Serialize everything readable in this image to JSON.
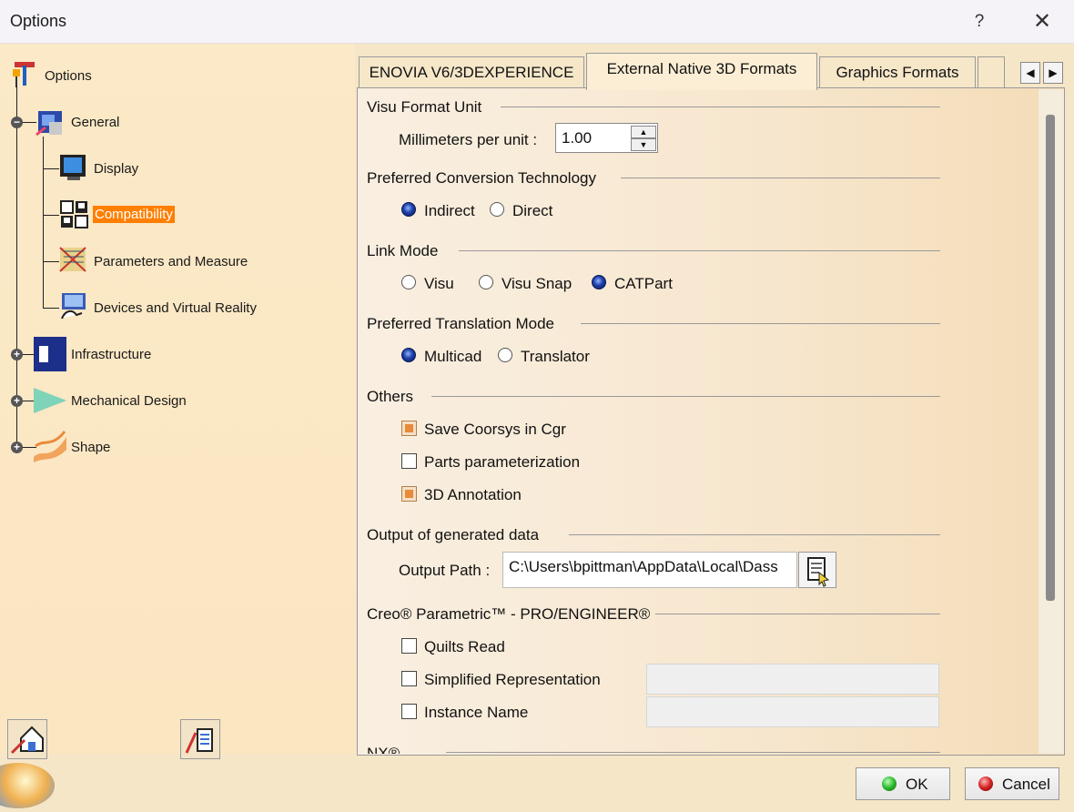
{
  "window": {
    "title": "Options",
    "help_label": "?",
    "close_label": "✕"
  },
  "tree": {
    "root": "Options",
    "items": [
      {
        "label": "General",
        "expander": "−"
      },
      {
        "label": "Display"
      },
      {
        "label": "Compatibility",
        "selected": true
      },
      {
        "label": "Parameters and Measure"
      },
      {
        "label": "Devices and Virtual Reality"
      },
      {
        "label": "Infrastructure",
        "expander": "+"
      },
      {
        "label": "Mechanical Design",
        "expander": "+"
      },
      {
        "label": "Shape",
        "expander": "+"
      }
    ]
  },
  "tabs": {
    "items": [
      "ENOVIA V6/3DEXPERIENCE",
      "External Native 3D Formats",
      "Graphics Formats"
    ],
    "active": "External Native 3D Formats",
    "prev_label": "◀",
    "next_label": "▶"
  },
  "visu": {
    "group": "Visu Format Unit",
    "label": "Millimeters per unit :",
    "value": "1.00"
  },
  "conversion": {
    "group": "Preferred Conversion Technology",
    "options": [
      "Indirect",
      "Direct"
    ],
    "selected": "Indirect"
  },
  "link_mode": {
    "group": "Link Mode",
    "options": [
      "Visu",
      "Visu Snap",
      "CATPart"
    ],
    "selected": "CATPart"
  },
  "translation": {
    "group": "Preferred Translation Mode",
    "options": [
      "Multicad",
      "Translator"
    ],
    "selected": "Multicad"
  },
  "others": {
    "group": "Others",
    "checks": [
      {
        "label": "Save Coorsys in Cgr",
        "checked": true
      },
      {
        "label": "Parts parameterization",
        "checked": false
      },
      {
        "label": "3D Annotation",
        "checked": true
      }
    ]
  },
  "output": {
    "group": "Output of generated data",
    "label": "Output Path :",
    "value": "C:\\Users\\bpittman\\AppData\\Local\\Dass"
  },
  "creo": {
    "group": "Creo® Parametric™ - PRO/ENGINEER®",
    "checks": [
      {
        "label": "Quilts Read",
        "checked": false
      },
      {
        "label": "Simplified Representation",
        "checked": false
      },
      {
        "label": "Instance Name",
        "checked": false
      }
    ]
  },
  "nx": {
    "group": "NX®"
  },
  "buttons": {
    "ok": "OK",
    "cancel": "Cancel"
  },
  "colors": {
    "selection": "#ff7f00",
    "ok_dot": "#2db82d",
    "cancel_dot": "#d42020"
  }
}
